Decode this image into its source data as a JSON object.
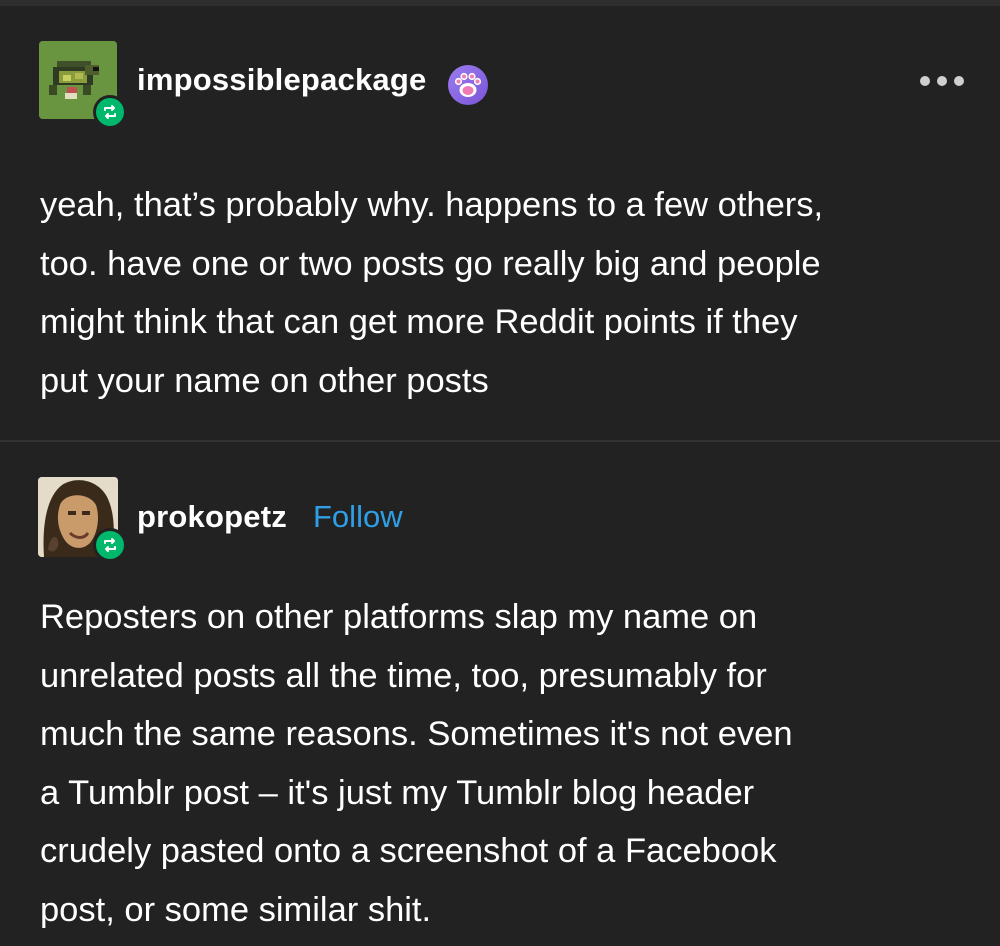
{
  "posts": [
    {
      "username": "impossiblepackage",
      "avatar": "turtle-pixel-avatar",
      "badge_icon": "paw-icon",
      "menu_icon": "more-options-icon",
      "reblog_icon": "reblog-icon",
      "body_lines": [
        "yeah, that’s probably why. happens to a few others,",
        "too. have one or two posts go really big and people",
        "might think that can get more Reddit points if they",
        "put your name on other posts"
      ]
    },
    {
      "username": "prokopetz",
      "follow_label": "Follow",
      "avatar": "portrait-avatar",
      "reblog_icon": "reblog-icon",
      "body_lines": [
        "Reposters on other platforms slap my name on",
        "unrelated posts all the time, too, presumably for",
        "much the same reasons. Sometimes it's not even",
        "a Tumblr post – it's just my Tumblr blog header",
        "crudely pasted onto a screenshot of a Facebook",
        "post, or some similar shit."
      ]
    }
  ],
  "colors": {
    "background": "#222222",
    "text": "#ffffff",
    "follow": "#2f9fe6",
    "reblog_badge": "#00b86b",
    "paw_badge": "#8f6ee8"
  }
}
